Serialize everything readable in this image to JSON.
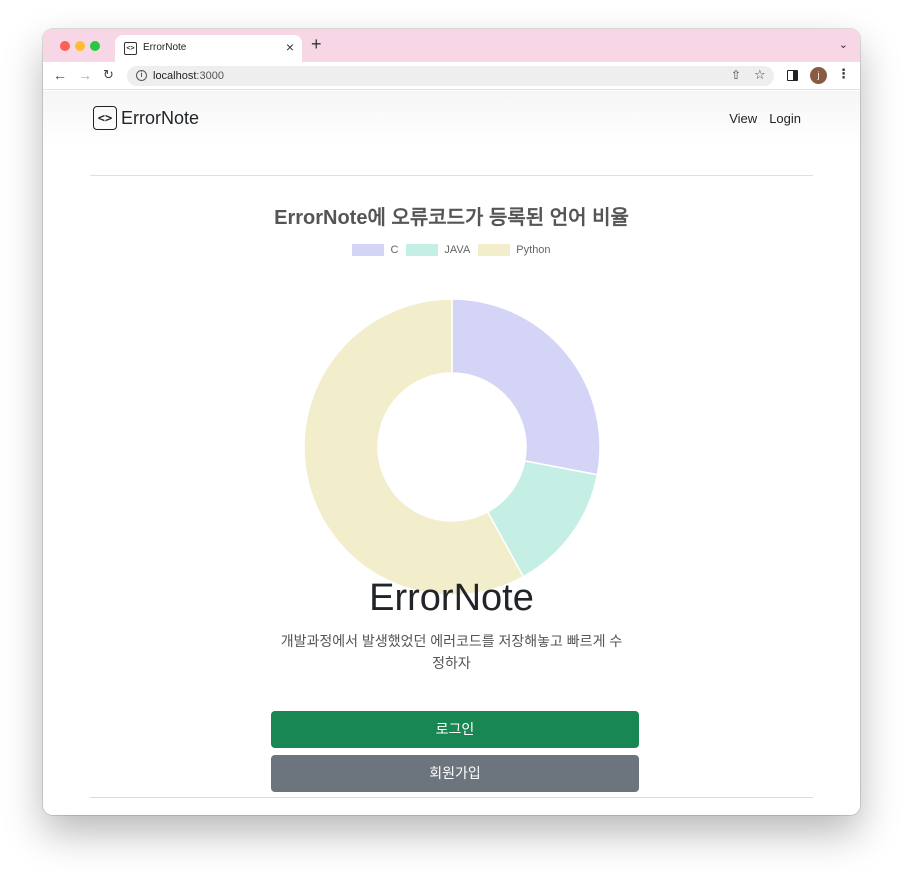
{
  "browser": {
    "tab_title": "ErrorNote",
    "new_tab_label": "+",
    "tab_close_label": "×",
    "url_host": "localhost",
    "url_port": ":3000",
    "avatar_letter": "j"
  },
  "navbar": {
    "brand_icon_text": "<>",
    "brand": "ErrorNote",
    "links": [
      "View",
      "Login"
    ]
  },
  "chart_title": "ErrorNote에 오류코드가 등록된 언어 비율",
  "chart_data": {
    "type": "doughnut",
    "title": "ErrorNote에 오류코드가 등록된 언어 비율",
    "labels": [
      "C",
      "JAVA",
      "Python"
    ],
    "values": [
      28,
      14,
      58
    ],
    "colors": [
      "#d4d4f7",
      "#c5efe5",
      "#f2edca"
    ],
    "legend": "top"
  },
  "hero": {
    "title": "ErrorNote",
    "subtitle": "개발과정에서 발생했었던 에러코드를 저장해놓고 빠르게 수정하자"
  },
  "buttons": {
    "login": "로그인",
    "signup": "회원가입"
  },
  "colors": {
    "tabstrip": "#f7d6e6",
    "login_button": "#198754",
    "signup_button": "#6c757d"
  }
}
